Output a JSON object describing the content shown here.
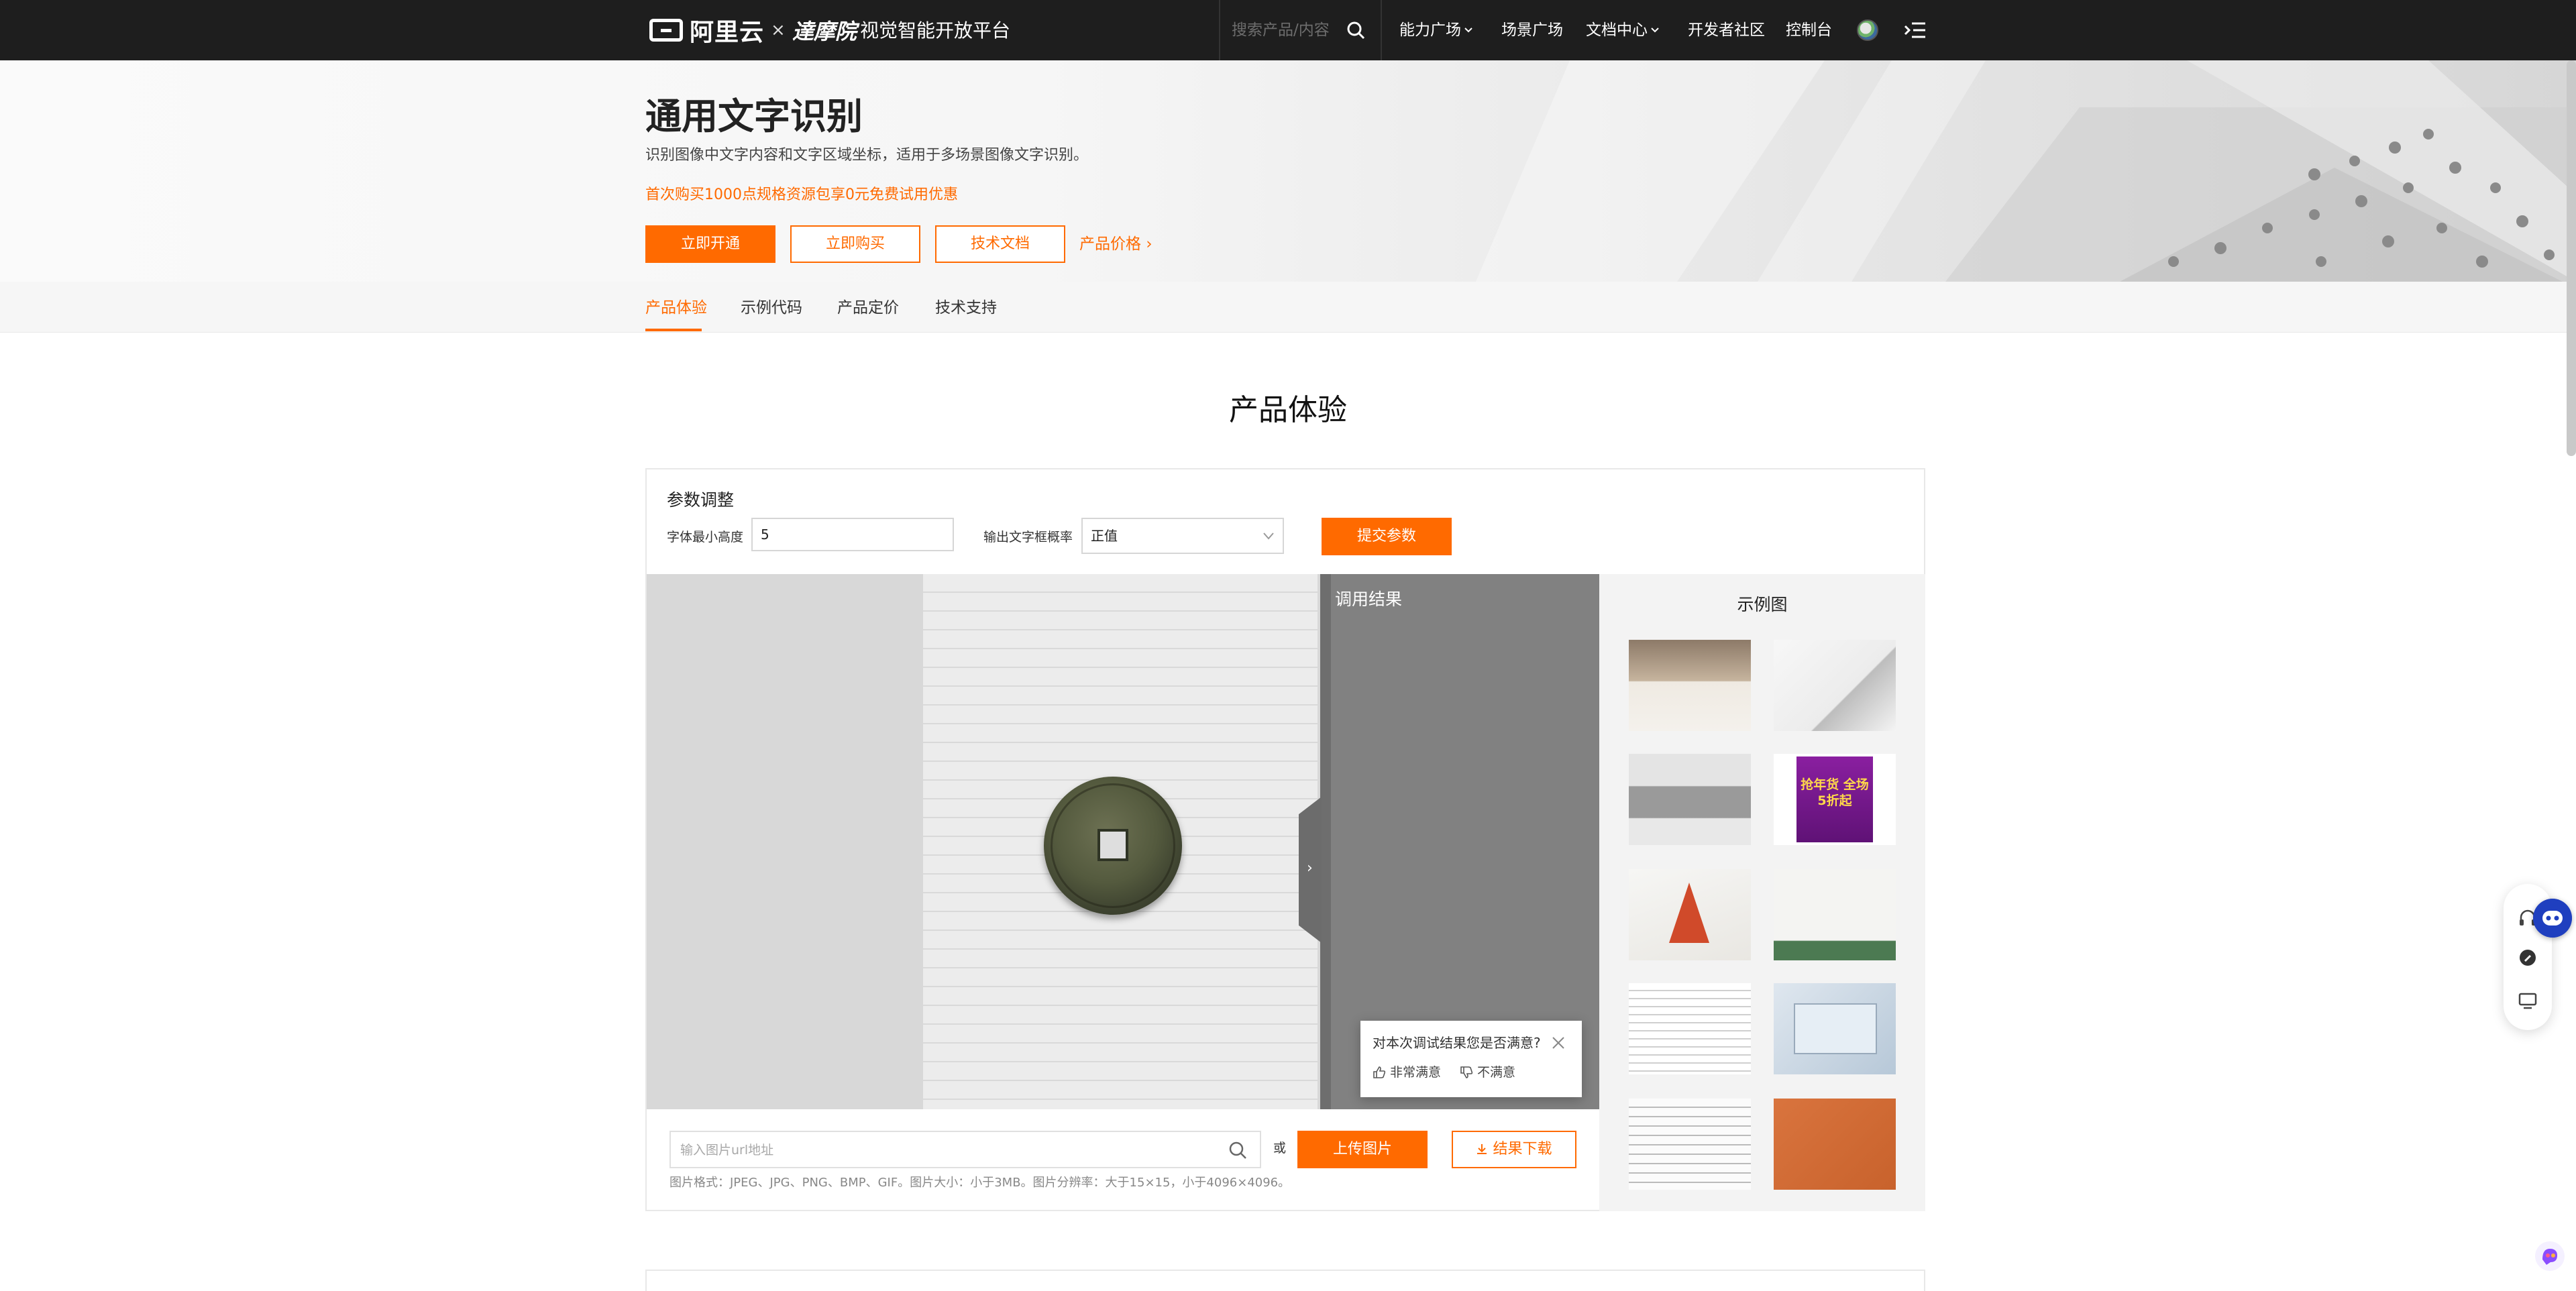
{
  "nav": {
    "brand": "阿里云",
    "brand_separator": "×",
    "partner": "達摩院",
    "platform_title": "视觉智能开放平台",
    "search_placeholder": "搜索产品/内容",
    "items": [
      "能力广场",
      "场景广场",
      "文档中心",
      "开发者社区",
      "控制台"
    ]
  },
  "hero": {
    "title": "通用文字识别",
    "description": "识别图像中文字内容和文字区域坐标，适用于多场景图像文字识别。",
    "promo": "首次购买1000点规格资源包享0元免费试用优惠",
    "buttons": {
      "activate": "立即开通",
      "buy": "立即购买",
      "docs": "技术文档"
    },
    "price_link": "产品价格",
    "price_chevron": "›"
  },
  "tabs": [
    "产品体验",
    "示例代码",
    "产品定价",
    "技术支持"
  ],
  "section_title": "产品体验",
  "params": {
    "title": "参数调整",
    "min_font_label": "字体最小高度",
    "min_font_value": "5",
    "prob_label": "输出文字框概率",
    "prob_value": "正值",
    "submit": "提交参数"
  },
  "stage": {
    "collapse_glyph": "›",
    "result_title": "调用结果"
  },
  "feedback": {
    "question": "对本次调试结果您是否满意?",
    "satisfied": "非常满意",
    "unsatisfied": "不满意"
  },
  "samples": {
    "title": "示例图",
    "thumb5_text": "抢年货 全场5折起"
  },
  "upload": {
    "url_placeholder": "输入图片url地址",
    "or": "或",
    "upload_button": "上传图片",
    "download_button": "结果下载",
    "format_hint": "图片格式：JPEG、JPG、PNG、BMP、GIF。图片大小：小于3MB。图片分辨率：大于15×15，小于4096×4096。"
  },
  "colors": {
    "accent": "#ff6a00",
    "nav_bg": "#1e1e1e",
    "result_bg": "#818181",
    "stage_bg": "#d8d8d8"
  },
  "icons": [
    "search-icon",
    "chevron-down-icon",
    "menu-icon",
    "close-icon",
    "thumbs-up-icon",
    "thumbs-down-icon",
    "download-icon",
    "headset-icon",
    "chat-bot-icon",
    "ai-assistant-icon"
  ]
}
